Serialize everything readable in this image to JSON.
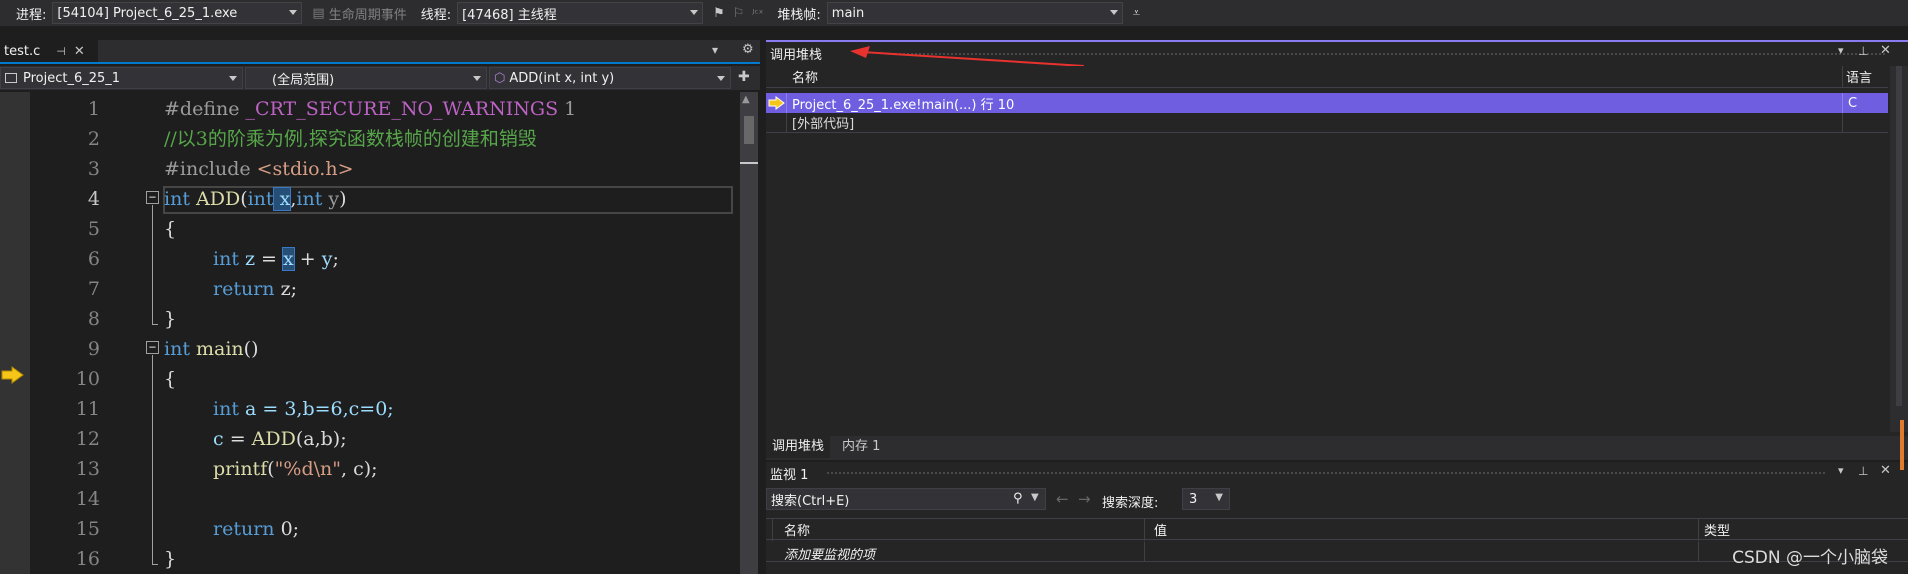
{
  "toolbar": {
    "process_label": "进程:",
    "process_value": "[54104] Project_6_25_1.exe",
    "lifecycle_label": "生命周期事件",
    "thread_label": "线程:",
    "thread_value": "[47468] 主线程",
    "stackframe_label": "堆栈帧:",
    "stackframe_value": "main"
  },
  "editor": {
    "tab_name": "test.c",
    "nav_project": "Project_6_25_1",
    "nav_scope": "(全局范围)",
    "nav_function": "ADD(int x, int y)",
    "line_numbers": [
      "1",
      "2",
      "3",
      "4",
      "5",
      "6",
      "7",
      "8",
      "9",
      "10",
      "11",
      "12",
      "13",
      "14",
      "15",
      "16"
    ],
    "current_line": "4",
    "execution_line": "10",
    "code": {
      "l1_pp": "#define ",
      "l1_macro": "_CRT_SECURE_NO_WARNINGS",
      "l1_val": " 1",
      "l2_comment": "//以3的阶乘为例,探究函数栈帧的创建和销毁",
      "l3_pp": "#include ",
      "l3_header": "<stdio.h>",
      "l4_int1": "int",
      "l4_fn": " ADD",
      "l4_open": "(",
      "l4_int2": "int",
      "l4_x": " x",
      "l4_comma": ",",
      "l4_int3": "int",
      "l4_y": " y",
      "l4_close": ")",
      "l5": "{",
      "l6_int": "int",
      "l6_z": " z",
      "l6_eq": " = ",
      "l6_x": "x",
      "l6_rest": " + ",
      "l6_y": "y",
      "l6_semi": ";",
      "l7_ret": "return",
      "l7_rest": " z;",
      "l8": "}",
      "l9_int": "int",
      "l9_fn": " main",
      "l9_rest": "()",
      "l10": "{",
      "l11_int": "int",
      "l11_rest": " a = 3,b=6,c=0;",
      "l12_c": "c",
      "l12_eq": " = ",
      "l12_fn": "ADD",
      "l12_rest": "(a,b);",
      "l13_fn": "printf",
      "l13_open": "(",
      "l13_str": "\"%d\\n\"",
      "l13_rest": ", c);",
      "l15_ret": "return",
      "l15_rest": " 0;",
      "l16": "}"
    }
  },
  "callstack": {
    "title": "调用堆栈",
    "col_name": "名称",
    "col_lang": "语言",
    "rows": [
      {
        "name": "Project_6_25_1.exe!main(...) 行 10",
        "lang": "C"
      },
      {
        "name": "[外部代码]",
        "lang": ""
      }
    ],
    "tab_callstack": "调用堆栈",
    "tab_memory": "内存 1"
  },
  "watch": {
    "title": "监视 1",
    "search_placeholder": "搜索(Ctrl+E)",
    "depth_label": "搜索深度:",
    "depth_value": "3",
    "col_name": "名称",
    "col_value": "值",
    "col_type": "类型",
    "add_item": "添加要监视的项"
  },
  "watermark": "CSDN @一个小脑袋",
  "colors": {
    "accent": "#007acc",
    "selection": "#6f5fe0",
    "annotation_arrow": "#e8322e"
  }
}
